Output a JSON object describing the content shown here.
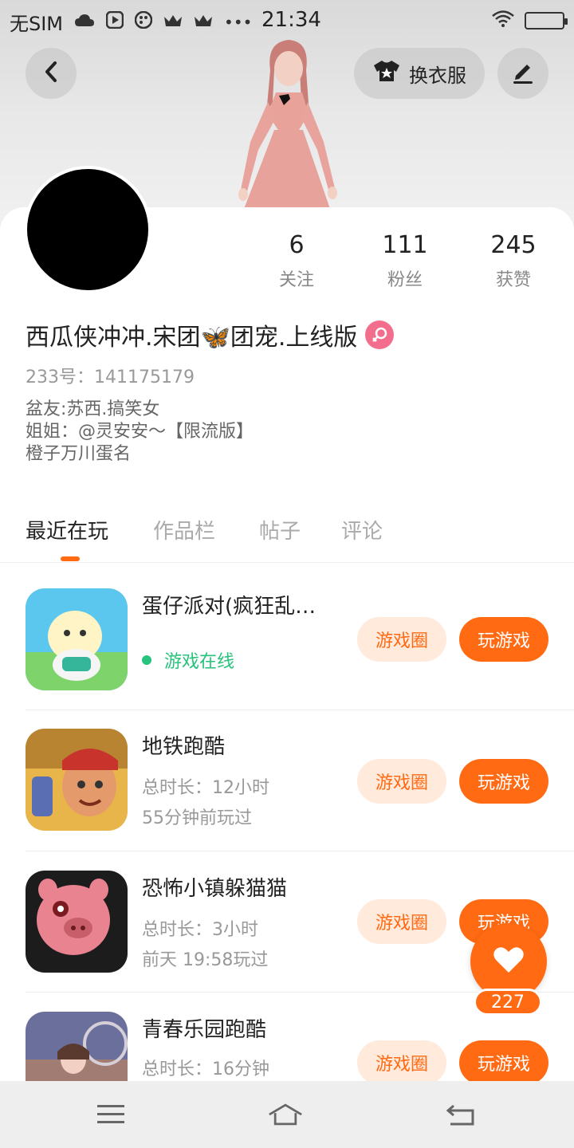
{
  "status_bar": {
    "carrier": "无SIM",
    "time": "21:34",
    "icons": [
      "cloud-icon",
      "play-icon",
      "palette-icon",
      "crown-icon",
      "crown-icon",
      "more-icon"
    ],
    "more": "•••"
  },
  "header": {
    "outfit_label": "换衣服"
  },
  "profile": {
    "stats": [
      {
        "value": "6",
        "label": "关注"
      },
      {
        "value": "111",
        "label": "粉丝"
      },
      {
        "value": "245",
        "label": "获赞"
      }
    ],
    "name": "西瓜侠冲冲.宋团🦋团宠.上线版",
    "id_text": "233号：141175179",
    "bio": [
      "盆友:苏西.搞笑女",
      "姐姐：@灵安安～【限流版】",
      "橙子万川蛋名"
    ]
  },
  "tabs": [
    {
      "label": "最近在玩",
      "active": true
    },
    {
      "label": "作品栏",
      "active": false
    },
    {
      "label": "帖子",
      "active": false
    },
    {
      "label": "评论",
      "active": false
    }
  ],
  "games": [
    {
      "title": "蛋仔派对(疯狂乱…",
      "status": "游戏在线",
      "circle_label": "游戏圈",
      "play_label": "玩游戏"
    },
    {
      "title": "地铁跑酷",
      "duration": "总时长：12小时",
      "last_played": "55分钟前玩过",
      "circle_label": "游戏圈",
      "play_label": "玩游戏"
    },
    {
      "title": "恐怖小镇躲猫猫",
      "duration": "总时长：3小时",
      "last_played": "前天 19:58玩过",
      "circle_label": "游戏圈",
      "play_label": "玩游戏"
    },
    {
      "title": "青春乐园跑酷",
      "duration": "总时长：16分钟",
      "circle_label": "游戏圈",
      "play_label": "玩游戏"
    }
  ],
  "like": {
    "count": "227"
  },
  "colors": {
    "accent": "#ff6a13",
    "online": "#27c27b",
    "gender": "#f36e8c"
  }
}
